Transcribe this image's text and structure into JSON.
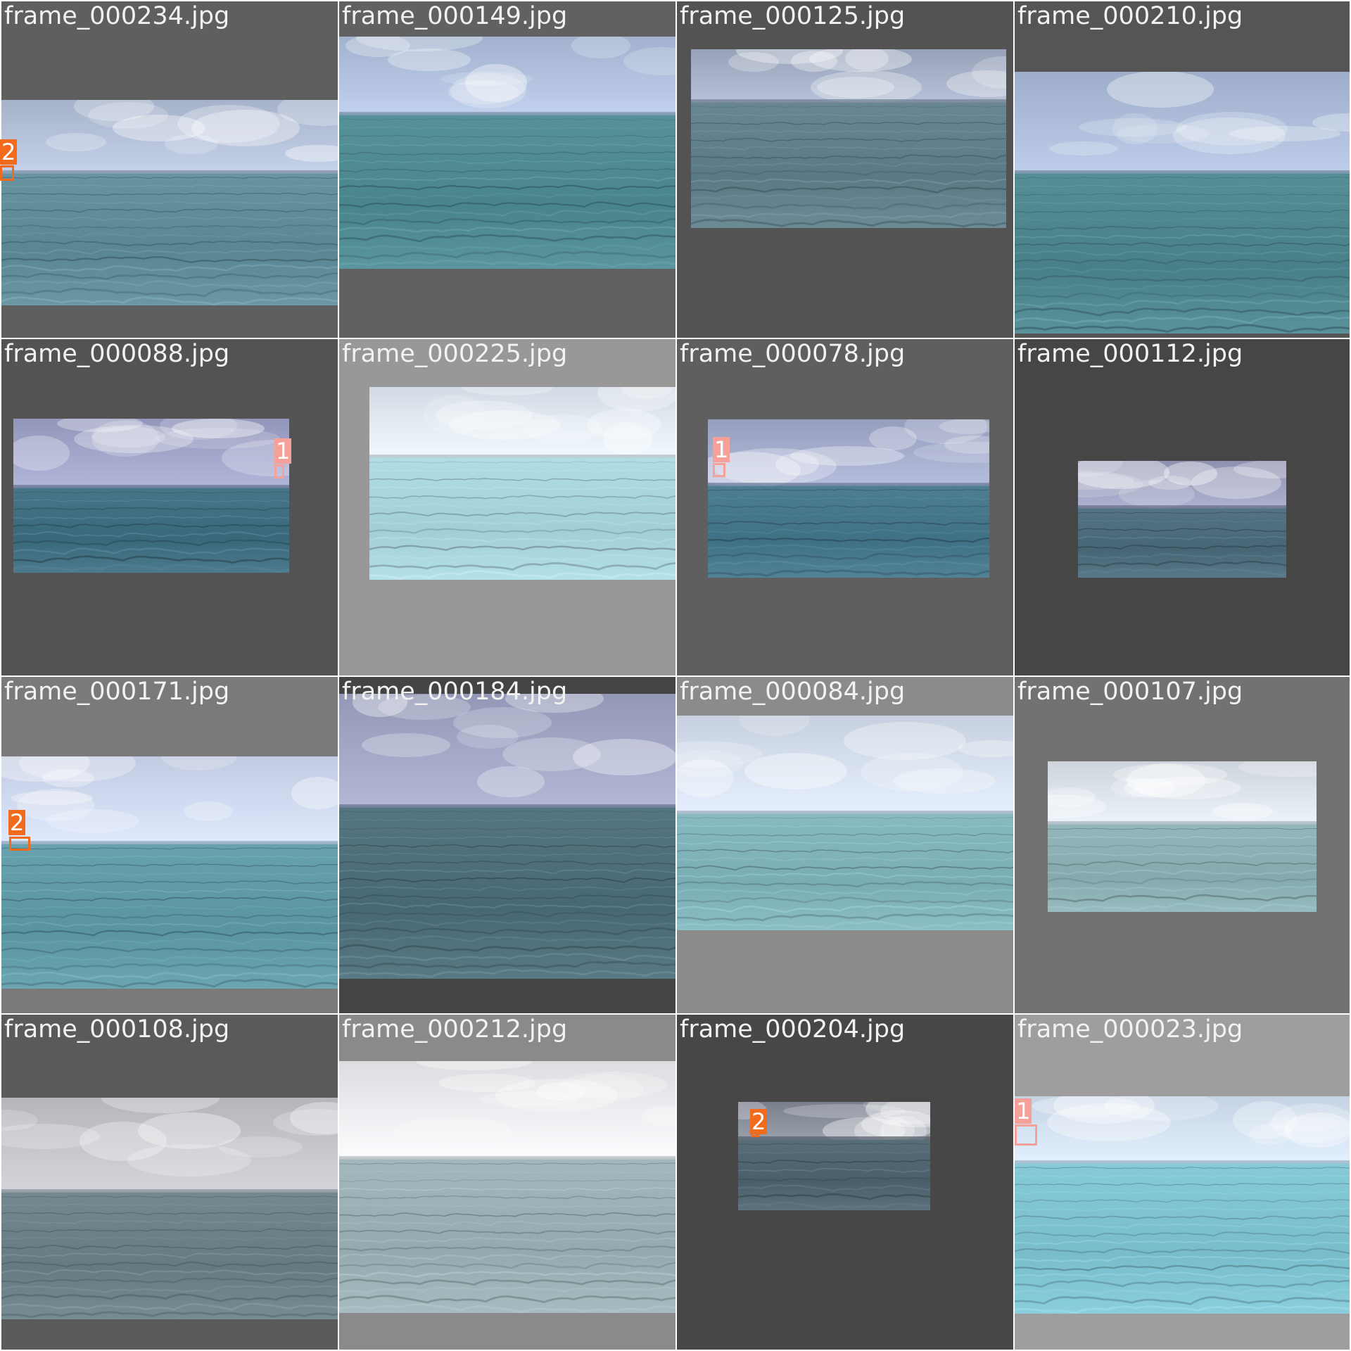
{
  "colors": {
    "separator": "#ffffff",
    "label_text": "#f2f2f2",
    "box_class_1": "#f6a09a",
    "box_class_2": "#f26a1b"
  },
  "tiles": [
    {
      "filename": "frame_000234.jpg",
      "bg": "#5f5f5f",
      "sky": "#b8c4dc",
      "sea": "#5f8c98",
      "labels": [
        {
          "id": "2",
          "class": "2"
        }
      ]
    },
    {
      "filename": "frame_000149.jpg",
      "bg": "#616161",
      "sky": "#b4c4e0",
      "sea": "#4f8a92",
      "labels": []
    },
    {
      "filename": "frame_000125.jpg",
      "bg": "#535353",
      "sky": "#a9b4ca",
      "sea": "#607f8a",
      "labels": []
    },
    {
      "filename": "frame_000210.jpg",
      "bg": "#555555",
      "sky": "#b0c0dc",
      "sea": "#4e8690",
      "labels": []
    },
    {
      "filename": "frame_000088.jpg",
      "bg": "#535353",
      "sky": "#a4a8cc",
      "sea": "#3f6e80",
      "labels": [
        {
          "id": "1",
          "class": "1"
        }
      ]
    },
    {
      "filename": "frame_000225.jpg",
      "bg": "#989898",
      "sky": "#e4ecf6",
      "sea": "#a8d4dc",
      "labels": []
    },
    {
      "filename": "frame_000078.jpg",
      "bg": "#5f5f5f",
      "sky": "#a8b0d0",
      "sea": "#45768a",
      "labels": [
        {
          "id": "1",
          "class": "1"
        }
      ]
    },
    {
      "filename": "frame_000112.jpg",
      "bg": "#464646",
      "sky": "#a0a4c2",
      "sea": "#4c6c7c",
      "labels": []
    },
    {
      "filename": "frame_000171.jpg",
      "bg": "#7a7a7a",
      "sky": "#d2dcf2",
      "sea": "#5f9aa6",
      "labels": [
        {
          "id": "2",
          "class": "2"
        }
      ]
    },
    {
      "filename": "frame_000184.jpg",
      "bg": "#444444",
      "sky": "#a4aac8",
      "sea": "#4d6e78",
      "labels": []
    },
    {
      "filename": "frame_000084.jpg",
      "bg": "#8b8b8b",
      "sky": "#d8e2f0",
      "sea": "#80b2ba",
      "labels": []
    },
    {
      "filename": "frame_000107.jpg",
      "bg": "#727272",
      "sky": "#e0e6ee",
      "sea": "#8ab0b4",
      "labels": []
    },
    {
      "filename": "frame_000108.jpg",
      "bg": "#5a5a5a",
      "sky": "#c6c8ce",
      "sea": "#6c8088",
      "labels": []
    },
    {
      "filename": "frame_000212.jpg",
      "bg": "#8a8a8a",
      "sky": "#eeeff2",
      "sea": "#9ab0b4",
      "labels": []
    },
    {
      "filename": "frame_000204.jpg",
      "bg": "#474747",
      "sky": "#8c919e",
      "sea": "#4f6670",
      "labels": [
        {
          "id": "2",
          "class": "2"
        }
      ]
    },
    {
      "filename": "frame_000023.jpg",
      "bg": "#9e9e9e",
      "sky": "#d6e4f6",
      "sea": "#7fc2d2",
      "labels": [
        {
          "id": "1",
          "class": "1"
        }
      ]
    }
  ]
}
